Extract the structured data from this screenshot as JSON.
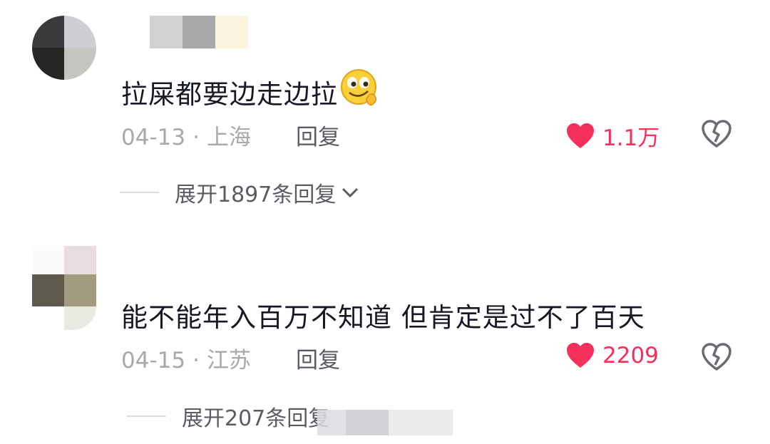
{
  "comments": [
    {
      "text": "拉屎都要边走边拉",
      "emoji_icon": "smirk-emoji",
      "date": "04-13",
      "location": "上海",
      "reply_label": "回复",
      "likes": "1.1万",
      "expand_label": "展开1897条回复",
      "colors": {
        "like": "#f5305a"
      }
    },
    {
      "text": "能不能年入百万不知道 但肯定是过不了百天",
      "date": "04-15",
      "location": "江苏",
      "reply_label": "回复",
      "likes": "2209",
      "expand_label": "展开207条回复",
      "colors": {
        "like": "#f5305a"
      }
    }
  ],
  "separator": "·"
}
